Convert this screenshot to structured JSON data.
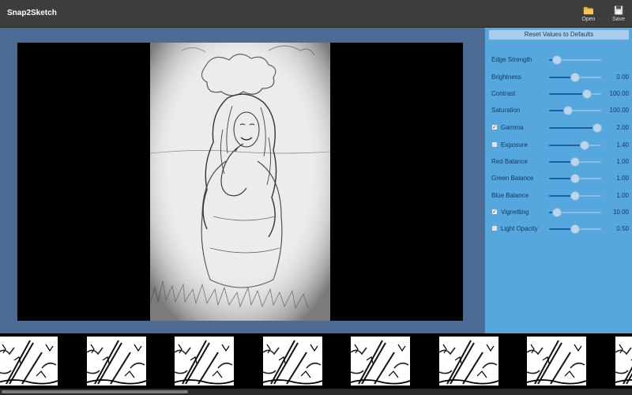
{
  "app": {
    "title": "Snap2Sketch"
  },
  "toolbar": {
    "open": {
      "label": "Open",
      "icon": "folder-icon"
    },
    "save": {
      "label": "Save",
      "icon": "floppy-disk-icon"
    }
  },
  "panel": {
    "reset_label": "Reset Values to Defaults",
    "controls": [
      {
        "label": "Edge Strength",
        "value": "",
        "level": 0.15,
        "checkbox": false,
        "checked": false
      },
      {
        "label": "Brightness",
        "value": "0.00",
        "level": 0.5,
        "checkbox": false,
        "checked": false
      },
      {
        "label": "Contrast",
        "value": "100.00",
        "level": 0.72,
        "checkbox": false,
        "checked": false
      },
      {
        "label": "Saturation",
        "value": "100.00",
        "level": 0.36,
        "checkbox": false,
        "checked": false
      },
      {
        "label": "Gamma",
        "value": "2.00",
        "level": 0.93,
        "checkbox": true,
        "checked": true
      },
      {
        "label": "Exposure",
        "value": "1.40",
        "level": 0.68,
        "checkbox": true,
        "checked": false
      },
      {
        "label": "Red Balance",
        "value": "1.00",
        "level": 0.5,
        "checkbox": false,
        "checked": false
      },
      {
        "label": "Green Balance",
        "value": "1.00",
        "level": 0.5,
        "checkbox": false,
        "checked": false
      },
      {
        "label": "Blue Balance",
        "value": "1.00",
        "level": 0.5,
        "checkbox": false,
        "checked": false
      },
      {
        "label": "Vignetting",
        "value": "10.00",
        "level": 0.15,
        "checkbox": true,
        "checked": true
      },
      {
        "label": "Light Opacity",
        "value": "0.50",
        "level": 0.5,
        "checkbox": true,
        "checked": false
      }
    ]
  },
  "filmstrip": {
    "thumbnail_count": 8
  },
  "colors": {
    "canvas_bg": "#4e6b93",
    "panel_bg": "#56a7de",
    "accent": "#1d5fa8"
  }
}
